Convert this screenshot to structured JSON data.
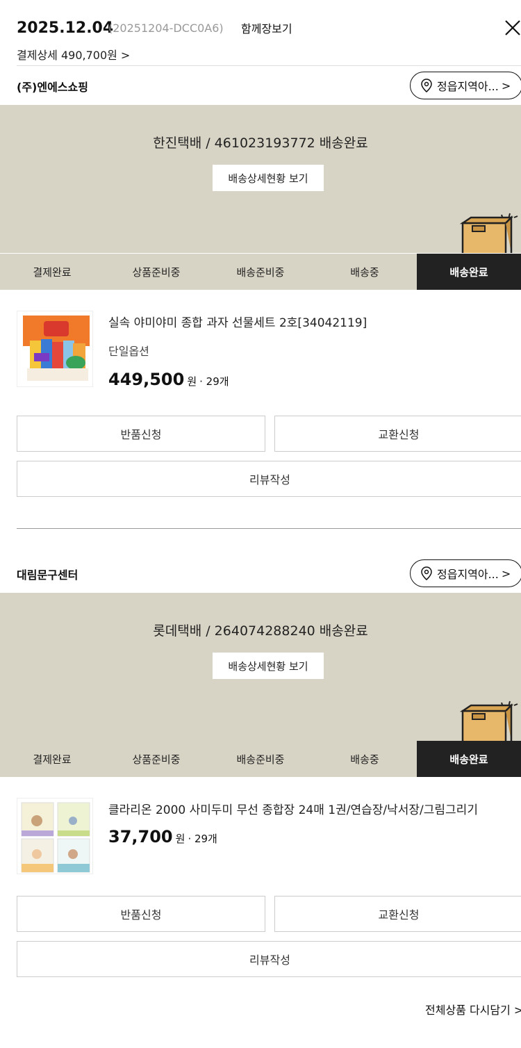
{
  "header": {
    "date": "2025.12.04",
    "order_id": "(20251204-DCC0A6)",
    "view_together": "함께장보기",
    "payment_detail": "결제상세 490,700원 >"
  },
  "shipments": [
    {
      "seller": "(주)엔에스쇼핑",
      "region": "정읍지역아...",
      "courier_status": "한진택배 / 461023193772 배송완료",
      "track_label": "배송상세현황 보기",
      "steps": [
        "결제완료",
        "상품준비중",
        "배송준비중",
        "배송중",
        "배송완료"
      ],
      "active_step": 4,
      "product": {
        "name": "실속 야미야미 종합 과자 선물세트 2호[34042119]",
        "option": "단일옵션",
        "price": "449,500",
        "unit": "원",
        "qty": "· 29개"
      },
      "buttons": {
        "return": "반품신청",
        "exchange": "교환신청",
        "review": "리뷰작성"
      }
    },
    {
      "seller": "대림문구센터",
      "region": "정읍지역아...",
      "courier_status": "롯데택배 / 264074288240 배송완료",
      "track_label": "배송상세현황 보기",
      "steps": [
        "결제완료",
        "상품준비중",
        "배송준비중",
        "배송중",
        "배송완료"
      ],
      "active_step": 4,
      "product": {
        "name": "클라리온 2000 사미두미 무선 종합장 24매 1권/연습장/낙서장/그림그리기",
        "price": "37,700",
        "unit": "원",
        "qty": "· 29개"
      },
      "buttons": {
        "return": "반품신청",
        "exchange": "교환신청",
        "review": "리뷰작성"
      }
    }
  ],
  "footer": {
    "readd_all": "전체상품 다시담기 >"
  }
}
